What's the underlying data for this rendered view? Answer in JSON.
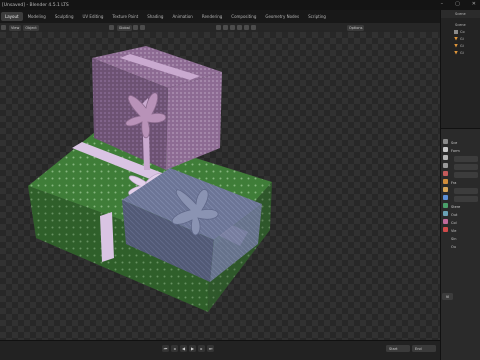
{
  "window": {
    "title": "[Unsaved] - Blender 4.5.1 LTS"
  },
  "workspaces": [
    "Layout",
    "Modeling",
    "Sculpting",
    "UV Editing",
    "Texture Paint",
    "Shading",
    "Animation",
    "Rendering",
    "Compositing",
    "Geometry Nodes",
    "Scripting"
  ],
  "viewport_header": {
    "view_menu": "View",
    "object_menu": "Object",
    "transform_orientation": "Global",
    "options_label": "Options"
  },
  "outliner": {
    "header_label": "Scene",
    "scene_label": "Scene",
    "rows": [
      "Co",
      "Gi",
      "Gi",
      "Gi"
    ]
  },
  "properties": {
    "rows": [
      "Sce",
      "Form",
      "Fra",
      "Stere",
      "Out",
      "Col",
      "Vie",
      "Sin",
      "Ou"
    ],
    "view_layer_btn": "Vi"
  },
  "timeline": {
    "start_label": "Start",
    "end_label": "End"
  },
  "colors": {
    "accent_active_tab": "#3d3d3d",
    "green_gift": "#3f7d38",
    "purple_gift": "#8d6b93",
    "blue_gift": "#6c7596",
    "ribbon_pink": "#d9c4e3"
  }
}
